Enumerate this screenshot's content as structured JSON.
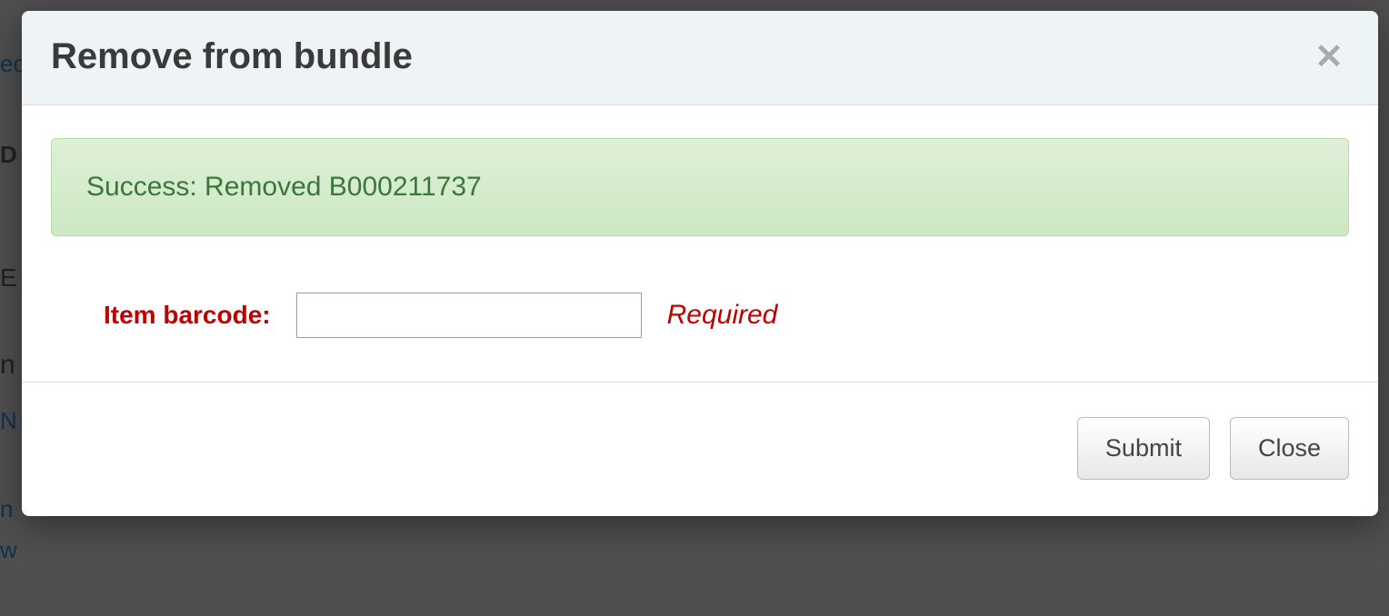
{
  "modal": {
    "title": "Remove from bundle",
    "close_aria": "Close dialog"
  },
  "alert": {
    "message": "Success: Removed B000211737"
  },
  "form": {
    "label": "Item barcode:",
    "value": "",
    "required_text": "Required"
  },
  "footer": {
    "submit_label": "Submit",
    "close_label": "Close"
  },
  "background_hints": {
    "t1": "ec",
    "t2": "D",
    "t3": "E",
    "t4": "n",
    "t5": "N",
    "t6": "n",
    "t7": "w"
  }
}
